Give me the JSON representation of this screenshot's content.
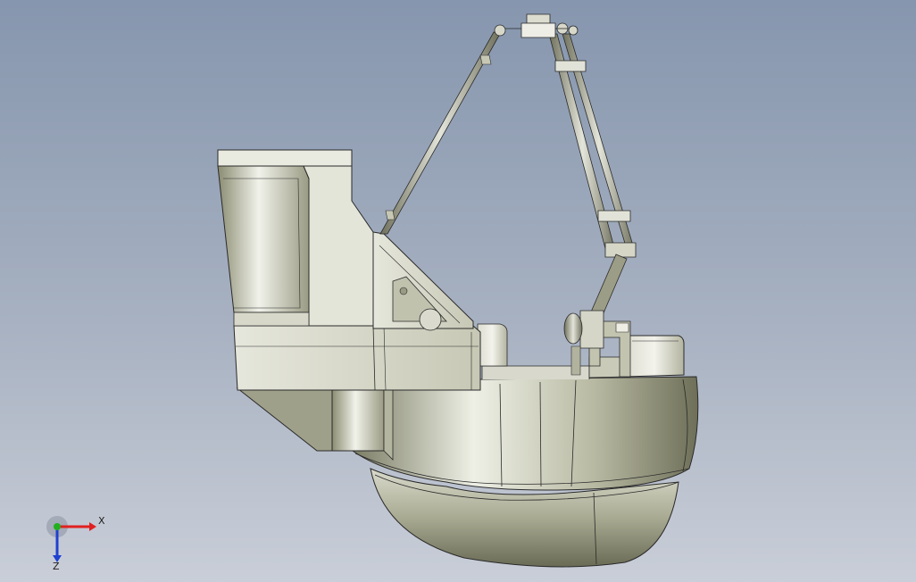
{
  "viewport": {
    "background_top": "#8696ae",
    "background_bottom": "#c9ced8"
  },
  "model": {
    "shade_light": "#eceee4",
    "shade_mid": "#c8c9b4",
    "shade_dark": "#73745e",
    "edge": "#2a2a2a"
  },
  "triad": {
    "x_label": "X",
    "z_label": "Z",
    "x_color": "#e02020",
    "y_color": "#20b020",
    "z_color": "#2040d0"
  }
}
